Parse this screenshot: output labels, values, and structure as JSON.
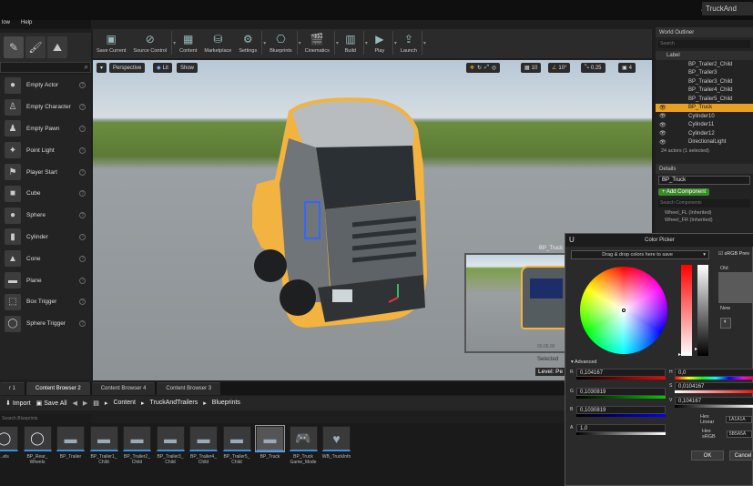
{
  "window": {
    "tab_label": "TruckAnd",
    "menu": [
      "low",
      "Help"
    ]
  },
  "modes": [
    {
      "icon": "mode-place-icon"
    },
    {
      "icon": "mode-paint-icon"
    },
    {
      "icon": "mode-landscape-icon"
    }
  ],
  "place": {
    "items": [
      {
        "label": "Empty Actor",
        "icon": "sphere-icon"
      },
      {
        "label": "Empty Character",
        "icon": "character-icon"
      },
      {
        "label": "Empty Pawn",
        "icon": "pawn-icon"
      },
      {
        "label": "Point Light",
        "icon": "light-icon"
      },
      {
        "label": "Player Start",
        "icon": "player-start-icon"
      },
      {
        "label": "Cube",
        "icon": "cube-icon"
      },
      {
        "label": "Sphere",
        "icon": "sphere-icon"
      },
      {
        "label": "Cylinder",
        "icon": "cylinder-icon"
      },
      {
        "label": "Cone",
        "icon": "cone-icon"
      },
      {
        "label": "Plane",
        "icon": "plane-icon"
      },
      {
        "label": "Box Trigger",
        "icon": "box-trigger-icon"
      },
      {
        "label": "Sphere Trigger",
        "icon": "sphere-trigger-icon"
      }
    ]
  },
  "toolbar": {
    "buttons": [
      {
        "label": "Save Current",
        "icon": "save-icon"
      },
      {
        "label": "Source Control",
        "icon": "source-control-icon"
      },
      {
        "label": "Content",
        "icon": "content-icon"
      },
      {
        "label": "Marketplace",
        "icon": "marketplace-icon"
      },
      {
        "label": "Settings",
        "icon": "settings-icon"
      },
      {
        "label": "Blueprints",
        "icon": "blueprints-icon"
      },
      {
        "label": "Cinematics",
        "icon": "cinematics-icon"
      },
      {
        "label": "Build",
        "icon": "build-icon"
      },
      {
        "label": "Play",
        "icon": "play-icon"
      },
      {
        "label": "Launch",
        "icon": "launch-icon"
      }
    ]
  },
  "viewport": {
    "perspective": "Perspective",
    "lit": "Lit",
    "show": "Show",
    "grid_snap": "10",
    "rot_snap": "10°",
    "scale_snap": "0.25",
    "cam_speed": "4",
    "pip_label": "BP_Truck",
    "pip_selected": "Selected",
    "pip_level": "Level: Pe",
    "pip_value": "00.00.00"
  },
  "content_tabs": [
    "r 1",
    "Content Browser 2",
    "Content Browser 4",
    "Content Browser 3"
  ],
  "content_browser": {
    "import": "Import",
    "save_all": "Save All",
    "path": [
      "Content",
      "TruckAndTrailers",
      "Blueprints"
    ],
    "search_placeholder": "Search Blueprints",
    "assets": [
      {
        "label": "...els"
      },
      {
        "label": "BP_Rear_\nWheels"
      },
      {
        "label": "BP_Trailer"
      },
      {
        "label": "BP_Trailer1_\nChild"
      },
      {
        "label": "BP_Trailer2_\nChild"
      },
      {
        "label": "BP_Trailer3_\nChild"
      },
      {
        "label": "BP_Trailer4_\nChild"
      },
      {
        "label": "BP_Trailer5_\nChild"
      },
      {
        "label": "BP_Truck"
      },
      {
        "label": "BP_Truck\nGame_Mode"
      },
      {
        "label": "WB_TruckInfo"
      }
    ]
  },
  "outliner": {
    "title": "World Outliner",
    "search_placeholder": "Search",
    "col_label": "Label",
    "rows": [
      "BP_Trailer2_Child",
      "BP_Trailer3",
      "BP_Trailer3_Child",
      "BP_Trailer4_Child",
      "BP_Trailer5_Child",
      "BP_Truck",
      "Cylinder10",
      "Cylinder11",
      "Cylinder12",
      "DirectionalLight"
    ],
    "selected": "BP_Truck",
    "status": "24 actors (1 selected)"
  },
  "details": {
    "title": "Details",
    "name_value": "BP_Truck",
    "add_component": "+ Add Component",
    "search_placeholder": "Search Components",
    "components": [
      "Wheel_FL (Inherited)",
      "Wheel_FR (Inherited)"
    ]
  },
  "color_picker": {
    "title": "Color Picker",
    "dropdown": "Drag & drop colors here to save",
    "srgb": "sRGB Prev",
    "old_label": "Old",
    "new_label": "New",
    "advanced": "Advanced",
    "r": "0,104167",
    "g": "0,1030819",
    "b": "0,1030819",
    "a": "1,0",
    "h": "0,0",
    "s": "0,0104167",
    "v": "0,104167",
    "hex_linear_label": "Hex Linear",
    "hex_linear": "1A1A1A",
    "hex_srgb_label": "Hex sRGB",
    "hex_srgb": "5B5A5A",
    "ok": "OK",
    "cancel": "Cancel",
    "accent": "#e8a020",
    "selection_color": "#f2b340"
  }
}
